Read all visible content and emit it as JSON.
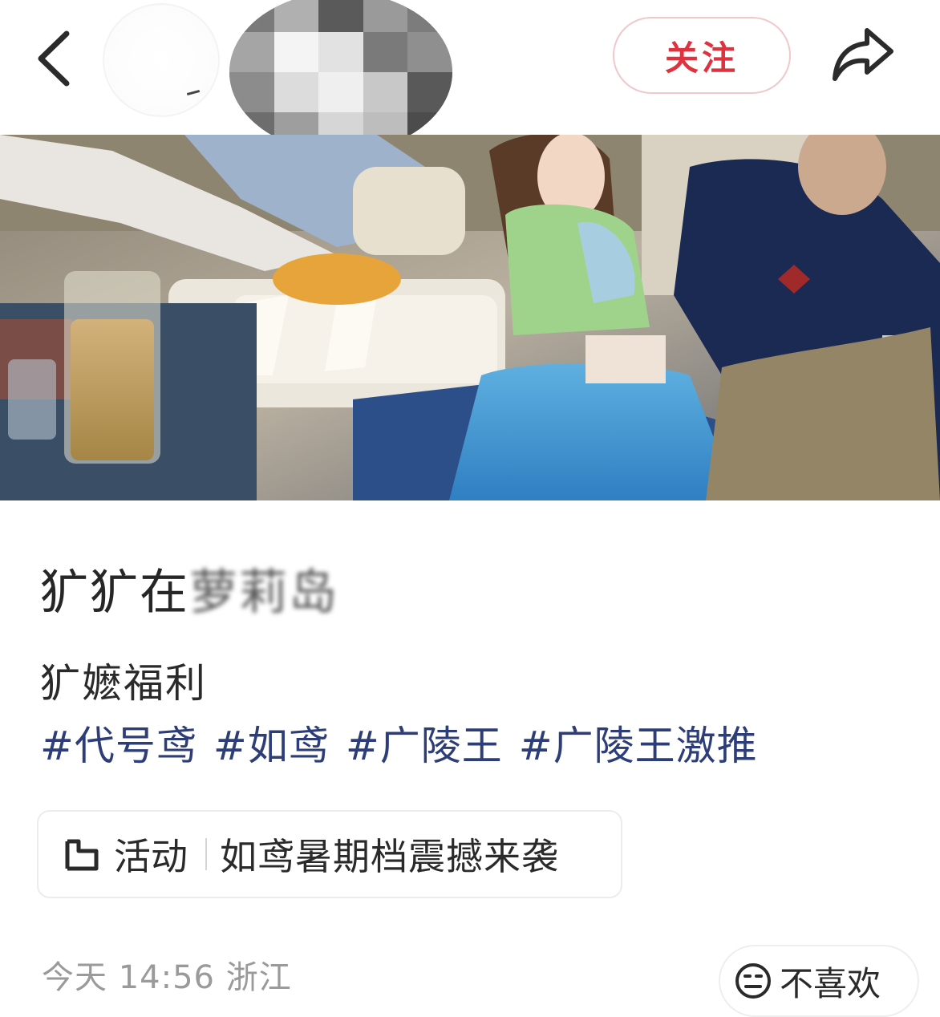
{
  "header": {
    "follow_label": "关注",
    "icons": {
      "back": "chevron-left-icon",
      "share": "share-arrow-icon"
    },
    "avatar_mosaic": [
      "#7a7a7a",
      "#b0b0b0",
      "#5a5a5a",
      "#9a9a9a",
      "#7c7c7c",
      "#a5a5a5",
      "#f4f4f4",
      "#e2e2e2",
      "#7a7a7a",
      "#8f8f8f",
      "#8c8c8c",
      "#dcdcdc",
      "#efefef",
      "#c8c8c8",
      "#595959",
      "#6d6d6d",
      "#9e9e9e",
      "#d6d6d6",
      "#bdbdbd",
      "#4c4c4c"
    ]
  },
  "post": {
    "title_visible": "犷犷在",
    "title_blurred": "萝莉岛",
    "subtitle": "犷嬷福利",
    "tags": [
      "#代号鸢",
      "#如鸢",
      "#广陵王",
      "#广陵王激推"
    ]
  },
  "activity": {
    "icon": "activity-flag-icon",
    "label": "活动",
    "text": "如鸢暑期档震撼来袭"
  },
  "meta": {
    "time_location": "今天 14:56 浙江"
  },
  "dislike": {
    "icon": "neutral-face-icon",
    "label": "不喜欢"
  },
  "colors": {
    "follow": "#e0313f",
    "tag": "#2d3d78",
    "meta": "#9a9a9a"
  }
}
